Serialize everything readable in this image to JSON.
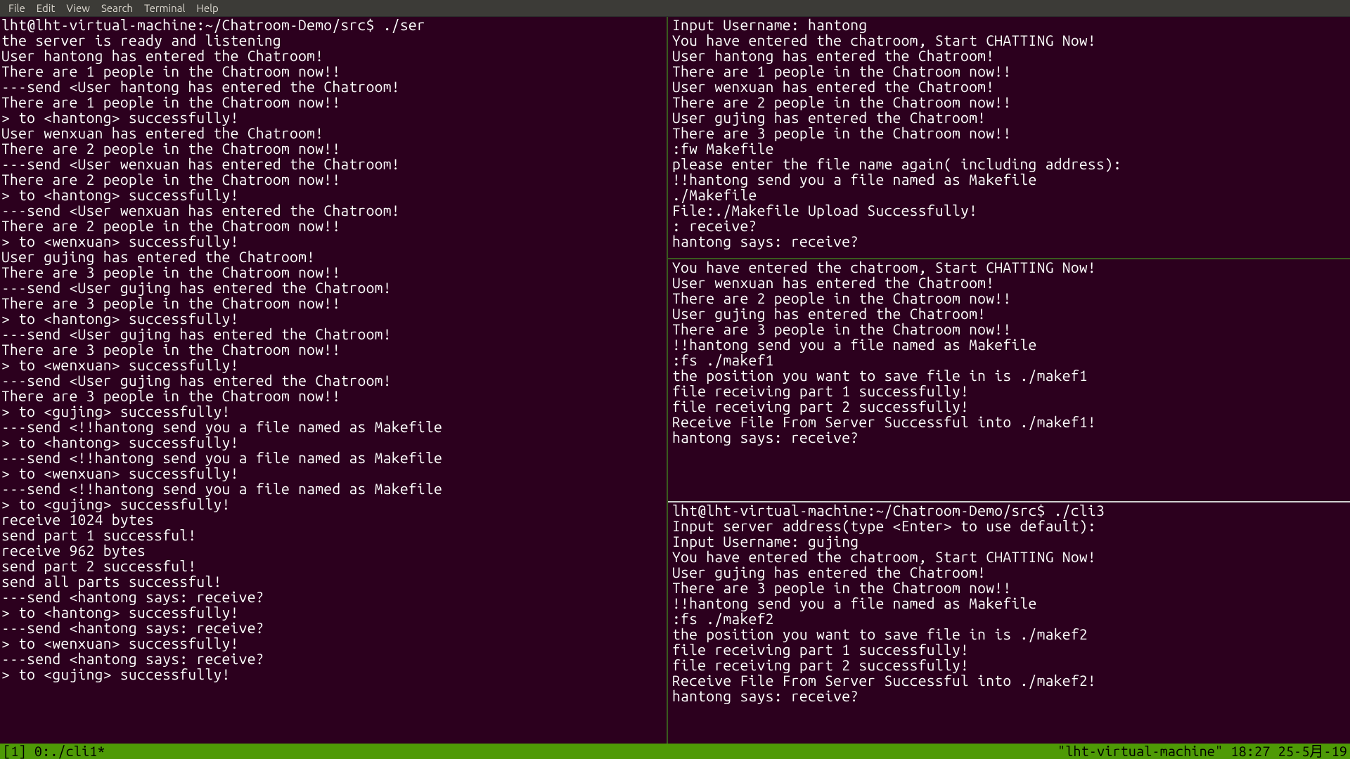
{
  "menubar": {
    "items": [
      "File",
      "Edit",
      "View",
      "Search",
      "Terminal",
      "Help"
    ]
  },
  "leftPane": {
    "lines": [
      "lht@lht-virtual-machine:~/Chatroom-Demo/src$ ./ser",
      "the server is ready and listening",
      "User hantong has entered the Chatroom!",
      "There are 1 people in the Chatroom now!!",
      "---send <User hantong has entered the Chatroom!",
      "There are 1 people in the Chatroom now!!",
      "> to <hantong> successfully!",
      "User wenxuan has entered the Chatroom!",
      "There are 2 people in the Chatroom now!!",
      "---send <User wenxuan has entered the Chatroom!",
      "There are 2 people in the Chatroom now!!",
      "> to <hantong> successfully!",
      "---send <User wenxuan has entered the Chatroom!",
      "There are 2 people in the Chatroom now!!",
      "> to <wenxuan> successfully!",
      "User gujing has entered the Chatroom!",
      "There are 3 people in the Chatroom now!!",
      "---send <User gujing has entered the Chatroom!",
      "There are 3 people in the Chatroom now!!",
      "> to <hantong> successfully!",
      "---send <User gujing has entered the Chatroom!",
      "There are 3 people in the Chatroom now!!",
      "> to <wenxuan> successfully!",
      "---send <User gujing has entered the Chatroom!",
      "There are 3 people in the Chatroom now!!",
      "> to <gujing> successfully!",
      "---send <!!hantong send you a file named as Makefile",
      "> to <hantong> successfully!",
      "---send <!!hantong send you a file named as Makefile",
      "> to <wenxuan> successfully!",
      "---send <!!hantong send you a file named as Makefile",
      "> to <gujing> successfully!",
      "receive 1024 bytes",
      "send part 1 successful!",
      "receive 962 bytes",
      "send part 2 successful!",
      "send all parts successful!",
      "---send <hantong says: receive?",
      "> to <hantong> successfully!",
      "---send <hantong says: receive?",
      "> to <wenxuan> successfully!",
      "---send <hantong says: receive?",
      "> to <gujing> successfully!"
    ]
  },
  "rightTop": {
    "lines": [
      "Input Username: hantong",
      "You have entered the chatroom, Start CHATTING Now!",
      "User hantong has entered the Chatroom!",
      "There are 1 people in the Chatroom now!!",
      "User wenxuan has entered the Chatroom!",
      "There are 2 people in the Chatroom now!!",
      "User gujing has entered the Chatroom!",
      "There are 3 people in the Chatroom now!!",
      ":fw Makefile",
      "please enter the file name again( including address):",
      "!!hantong send you a file named as Makefile",
      "./Makefile",
      "File:./Makefile Upload Successfully!",
      ": receive?",
      "hantong says: receive?"
    ]
  },
  "rightMid": {
    "lines": [
      "You have entered the chatroom, Start CHATTING Now!",
      "User wenxuan has entered the Chatroom!",
      "There are 2 people in the Chatroom now!!",
      "User gujing has entered the Chatroom!",
      "There are 3 people in the Chatroom now!!",
      "!!hantong send you a file named as Makefile",
      ":fs ./makef1",
      "the position you want to save file in is ./makef1",
      "file receiving part 1 successfully!",
      "file receiving part 2 successfully!",
      "Receive File From Server Successful into ./makef1!",
      "hantong says: receive?"
    ]
  },
  "rightBot": {
    "lines": [
      "lht@lht-virtual-machine:~/Chatroom-Demo/src$ ./cli3",
      "Input server address(type <Enter> to use default):",
      "Input Username: gujing",
      "You have entered the chatroom, Start CHATTING Now!",
      "User gujing has entered the Chatroom!",
      "There are 3 people in the Chatroom now!!",
      "!!hantong send you a file named as Makefile",
      ":fs ./makef2",
      "the position you want to save file in is ./makef2",
      "file receiving part 1 successfully!",
      "file receiving part 2 successfully!",
      "Receive File From Server Successful into ./makef2!",
      "hantong says: receive?"
    ]
  },
  "statusbar": {
    "left": "[1] 0:./cli1*",
    "right": "\"lht-virtual-machine\" 18:27 25-5月-19"
  }
}
